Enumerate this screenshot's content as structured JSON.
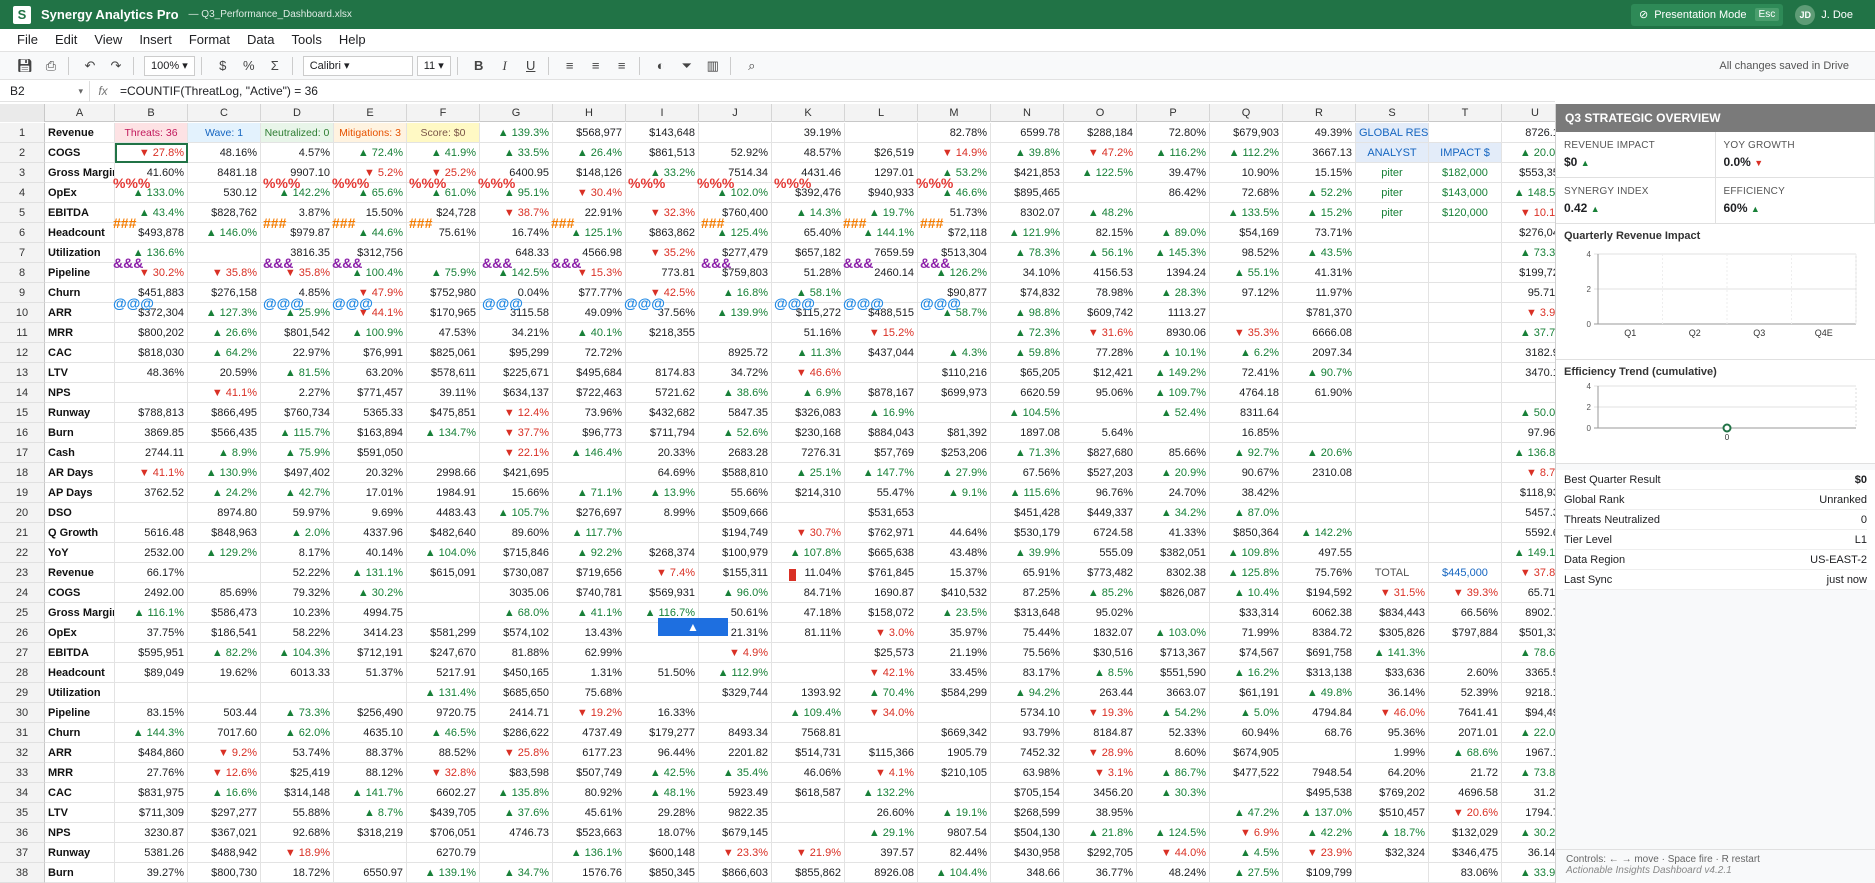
{
  "titlebar": {
    "logo": "S",
    "app_name": "Synergy Analytics Pro",
    "doc_name": "— Q3_Performance_Dashboard.xlsx",
    "pres_label": "Presentation Mode",
    "pres_key": "Esc",
    "user_initials": "JD",
    "user_name": "J. Doe"
  },
  "menu": [
    "File",
    "Edit",
    "View",
    "Insert",
    "Format",
    "Data",
    "Tools",
    "Help"
  ],
  "toolbar": {
    "zoom": "100% ▾",
    "font": "Calibri ▾",
    "size": "11 ▾",
    "saved": "All changes saved in Drive"
  },
  "formula": {
    "cell": "B2",
    "fx": "fx",
    "text": "=COUNTIF(ThreatLog, \"Active\") = 36"
  },
  "columns": [
    "A",
    "B",
    "C",
    "D",
    "E",
    "F",
    "G",
    "H",
    "I",
    "J",
    "K",
    "L",
    "M",
    "N",
    "O",
    "P",
    "Q",
    "R",
    "S",
    "T",
    "U"
  ],
  "rows": [
    [
      "Revenue",
      "Threats: 36",
      "Wave: 1",
      "Neutralized: 0",
      "Mitigations: 3",
      "Score: $0",
      "▲ 139.3%",
      "$568,977",
      "$143,648",
      "",
      "39.19%",
      "",
      "82.78%",
      "6599.78",
      "$288,184",
      "72.80%",
      "$679,903",
      "49.39%",
      "GLOBAL RES",
      "",
      "8726.10"
    ],
    [
      "COGS",
      "▼ 27.8%",
      "48.16%",
      "4.57%",
      "▲ 72.4%",
      "▲ 41.9%",
      "▲ 33.5%",
      "▲ 26.4%",
      "$861,513",
      "52.92%",
      "48.57%",
      "$26,519",
      "▼ 14.9%",
      "▲ 39.8%",
      "▼ 47.2%",
      "▲ 116.2%",
      "▲ 112.2%",
      "3667.13",
      "ANALYST",
      "IMPACT $",
      "▲ 20.0%"
    ],
    [
      "Gross Margin",
      "41.60%",
      "8481.18",
      "9907.10",
      "▼ 5.2%",
      "▼ 25.2%",
      "6400.95",
      "$148,126",
      "▲ 33.2%",
      "7514.34",
      "4431.46",
      "1297.01",
      "▲ 53.2%",
      "$421,853",
      "▲ 122.5%",
      "39.47%",
      "10.90%",
      "15.15%",
      "piter",
      "$182,000",
      "$553,354"
    ],
    [
      "OpEx",
      "▲ 133.0%",
      "530.12",
      "▲ 142.2%",
      "▲ 65.6%",
      "▲ 61.0%",
      "▲ 95.1%",
      "▼ 30.4%",
      "",
      "▲ 102.0%",
      "$392,476",
      "$940,933",
      "▲ 46.6%",
      "$895,465",
      "",
      "86.42%",
      "72.68%",
      "▲ 52.2%",
      "piter",
      "$143,000",
      "▲ 148.5%"
    ],
    [
      "EBITDA",
      "▲ 43.4%",
      "$828,762",
      "3.87%",
      "15.50%",
      "$24,728",
      "▼ 38.7%",
      "22.91%",
      "▼ 32.3%",
      "$760,400",
      "▲ 14.3%",
      "▲ 19.7%",
      "51.73%",
      "8302.07",
      "▲ 48.2%",
      "",
      "▲ 133.5%",
      "▲ 15.2%",
      "piter",
      "$120,000",
      "▼ 10.1%"
    ],
    [
      "Headcount",
      "$493,878",
      "▲ 146.0%",
      "$979.87",
      "▲ 44.6%",
      "75.61%",
      "16.74%",
      "▲ 125.1%",
      "$863,862",
      "▲ 125.4%",
      "65.40%",
      "▲ 144.1%",
      "$72,118",
      "▲ 121.9%",
      "82.15%",
      "▲ 89.0%",
      "$54,169",
      "73.71%",
      "",
      "",
      "$276,045"
    ],
    [
      "Utilization",
      "▲ 136.6%",
      "",
      "3816.35",
      "$312,756",
      "",
      "648.33",
      "4566.98",
      "▼ 35.2%",
      "$277,479",
      "$657,182",
      "7659.59",
      "$513,304",
      "▲ 78.3%",
      "▲ 56.1%",
      "▲ 145.3%",
      "98.52%",
      "▲ 43.5%",
      "",
      "",
      "▲ 73.3%"
    ],
    [
      "Pipeline",
      "▼ 30.2%",
      "▼ 35.8%",
      "▼ 35.8%",
      "▲ 100.4%",
      "▲ 75.9%",
      "▲ 142.5%",
      "▼ 15.3%",
      "773.81",
      "$759,803",
      "51.28%",
      "2460.14",
      "▲ 126.2%",
      "34.10%",
      "4156.53",
      "1394.24",
      "▲ 55.1%",
      "41.31%",
      "",
      "",
      "$199,725"
    ],
    [
      "Churn",
      "$451,883",
      "$276,158",
      "4.85%",
      "▼ 47.9%",
      "$752,980",
      "0.04%",
      "$77.77%",
      "▼ 42.5%",
      "▲ 16.8%",
      "▲ 58.1%",
      "",
      "$90,877",
      "$74,832",
      "78.98%",
      "▲ 28.3%",
      "97.12%",
      "11.97%",
      "",
      "",
      "95.71%"
    ],
    [
      "ARR",
      "$372,304",
      "▲ 127.3%",
      "▲ 25.9%",
      "▼ 44.1%",
      "$170,965",
      "3115.58",
      "49.09%",
      "37.56%",
      "▲ 139.9%",
      "$115,272",
      "$488,515",
      "▲ 58.7%",
      "▲ 98.8%",
      "$609,742",
      "1113.27",
      "",
      "$781,370",
      "",
      "",
      "▼ 3.9%"
    ],
    [
      "MRR",
      "$800,202",
      "▲ 26.6%",
      "$801,542",
      "▲ 100.9%",
      "47.53%",
      "34.21%",
      "▲ 40.1%",
      "$218,355",
      "",
      "51.16%",
      "▼ 15.2%",
      "",
      "▲ 72.3%",
      "▼ 31.6%",
      "8930.06",
      "▼ 35.3%",
      "6666.08",
      "",
      "",
      "▲ 37.7%"
    ],
    [
      "CAC",
      "$818,030",
      "▲ 64.2%",
      "22.97%",
      "$76,991",
      "$825,061",
      "$95,299",
      "72.72%",
      "",
      "8925.72",
      "▲ 11.3%",
      "$437,044",
      "▲ 4.3%",
      "▲ 59.8%",
      "77.28%",
      "▲ 10.1%",
      "▲ 6.2%",
      "2097.34",
      "",
      "",
      "3182.97"
    ],
    [
      "LTV",
      "48.36%",
      "20.59%",
      "▲ 81.5%",
      "63.20%",
      "$578,611",
      "$225,671",
      "$495,684",
      "8174.83",
      "34.72%",
      "▼ 46.6%",
      "",
      "$110,216",
      "$65,205",
      "$12,421",
      "▲ 149.2%",
      "72.41%",
      "▲ 90.7%",
      "",
      "",
      "3470.16"
    ],
    [
      "NPS",
      "",
      "▼ 41.1%",
      "2.27%",
      "$771,457",
      "39.11%",
      "$634,137",
      "$722,463",
      "5721.62",
      "▲ 38.6%",
      "▲ 6.9%",
      "$878,167",
      "$699,973",
      "6620.59",
      "95.06%",
      "▲ 109.7%",
      "4764.18",
      "61.90%",
      "",
      "",
      ""
    ],
    [
      "Runway",
      "$788,813",
      "$866,495",
      "$760,734",
      "5365.33",
      "$475,851",
      "▼ 12.4%",
      "73.96%",
      "$432,682",
      "5847.35",
      "$326,083",
      "▲ 16.9%",
      "",
      "▲ 104.5%",
      "",
      "▲ 52.4%",
      "8311.64",
      "",
      "",
      "",
      "▲ 50.0%"
    ],
    [
      "Burn",
      "3869.85",
      "$566,435",
      "▲ 115.7%",
      "$163,894",
      "▲ 134.7%",
      "▼ 37.7%",
      "$96,773",
      "$711,794",
      "▲ 52.6%",
      "$230,168",
      "$884,043",
      "$81,392",
      "1897.08",
      "5.64%",
      "",
      "16.85%",
      "",
      "",
      "",
      "97.96%"
    ],
    [
      "Cash",
      "2744.11",
      "▲ 8.9%",
      "▲ 75.9%",
      "$591,050",
      "",
      "▼ 22.1%",
      "▲ 146.4%",
      "20.33%",
      "2683.28",
      "7276.31",
      "$57,769",
      "$253,206",
      "▲ 71.3%",
      "$827,680",
      "85.66%",
      "▲ 92.7%",
      "▲ 20.6%",
      "",
      "",
      "▲ 136.8%"
    ],
    [
      "AR Days",
      "▼ 41.1%",
      "▲ 130.9%",
      "$497,402",
      "20.32%",
      "2998.66",
      "$421,695",
      "",
      "64.69%",
      "$588,810",
      "▲ 25.1%",
      "▲ 147.7%",
      "▲ 27.9%",
      "67.56%",
      "$527,203",
      "▲ 20.9%",
      "90.67%",
      "2310.08",
      "",
      "",
      "▼ 8.7%"
    ],
    [
      "AP Days",
      "3762.52",
      "▲ 24.2%",
      "▲ 42.7%",
      "17.01%",
      "1984.91",
      "15.66%",
      "▲ 71.1%",
      "▲ 13.9%",
      "55.66%",
      "$214,310",
      "55.47%",
      "▲ 9.1%",
      "▲ 115.6%",
      "96.76%",
      "24.70%",
      "38.42%",
      "",
      "",
      "",
      "$118,930"
    ],
    [
      "DSO",
      "",
      "8974.80",
      "59.97%",
      "9.69%",
      "4483.43",
      "▲ 105.7%",
      "$276,697",
      "8.99%",
      "$509,666",
      "",
      "$531,653",
      "",
      "$451,428",
      "$449,337",
      "▲ 34.2%",
      "▲ 87.0%",
      "",
      "",
      "",
      "5457.38"
    ],
    [
      "Q Growth",
      "5616.48",
      "$848,963",
      "▲ 2.0%",
      "4337.96",
      "$482,640",
      "89.60%",
      "▲ 117.7%",
      "",
      "$194,749",
      "▼ 30.7%",
      "$762,971",
      "44.64%",
      "$530,179",
      "6724.58",
      "41.33%",
      "$850,364",
      "▲ 142.2%",
      "",
      "",
      "5592.66"
    ],
    [
      "YoY",
      "2532.00",
      "▲ 129.2%",
      "8.17%",
      "40.14%",
      "▲ 104.0%",
      "$715,846",
      "▲ 92.2%",
      "$268,374",
      "$100,979",
      "▲ 107.8%",
      "$665,638",
      "43.48%",
      "▲ 39.9%",
      "555.09",
      "$382,051",
      "▲ 109.8%",
      "497.55",
      "",
      "",
      "▲ 149.1%"
    ],
    [
      "Revenue",
      "66.17%",
      "",
      "52.22%",
      "▲ 131.1%",
      "$615,091",
      "$730,087",
      "$719,656",
      "▼ 7.4%",
      "$155,311",
      "11.04%",
      "$761,845",
      "15.37%",
      "65.91%",
      "$773,482",
      "8302.38",
      "▲ 125.8%",
      "75.76%",
      "TOTAL",
      "$445,000",
      "▼ 37.8%"
    ],
    [
      "COGS",
      "2492.00",
      "85.69%",
      "79.32%",
      "▲ 30.2%",
      "",
      "3035.06",
      "$740,781",
      "$569,931",
      "▲ 96.0%",
      "84.71%",
      "1690.87",
      "$410,532",
      "87.25%",
      "▲ 85.2%",
      "$826,087",
      "▲ 10.4%",
      "$194,592",
      "▼ 31.5%",
      "▼ 39.3%",
      "65.71%"
    ],
    [
      "Gross Margin",
      "▲ 116.1%",
      "$586,473",
      "10.23%",
      "4994.75",
      "",
      "▲ 68.0%",
      "▲ 41.1%",
      "▲ 116.7%",
      "50.61%",
      "47.18%",
      "$158,072",
      "▲ 23.5%",
      "$313,648",
      "95.02%",
      "",
      "$33,314",
      "6062.38",
      "$834,443",
      "66.56%",
      "8902.72"
    ],
    [
      "OpEx",
      "37.75%",
      "$186,541",
      "58.22%",
      "3414.23",
      "$581,299",
      "$574,102",
      "13.43%",
      "",
      "21.31%",
      "81.11%",
      "▼ 3.0%",
      "35.97%",
      "75.44%",
      "1832.07",
      "▲ 103.0%",
      "71.99%",
      "8384.72",
      "$305,826",
      "$797,884",
      "$501,334"
    ],
    [
      "EBITDA",
      "$595,951",
      "▲ 82.2%",
      "▲ 104.3%",
      "$712,191",
      "$247,670",
      "81.88%",
      "62.99%",
      "",
      "▼ 4.9%",
      "",
      "$25,573",
      "21.19%",
      "75.56%",
      "$30,516",
      "$713,367",
      "$74,567",
      "$691,758",
      "▲ 141.3%",
      "",
      "▲ 78.6%"
    ],
    [
      "Headcount",
      "$89,049",
      "19.62%",
      "6013.33",
      "51.37%",
      "5217.91",
      "$450,165",
      "1.31%",
      "51.50%",
      "▲ 112.9%",
      "",
      "▼ 42.1%",
      "33.45%",
      "83.17%",
      "▲ 8.5%",
      "$551,590",
      "▲ 16.2%",
      "$313,138",
      "$33,636",
      "2.60%",
      "3365.54"
    ],
    [
      "Utilization",
      "",
      "",
      "",
      "",
      "▲ 131.4%",
      "$685,650",
      "75.68%",
      "",
      "$329,744",
      "1393.92",
      "▲ 70.4%",
      "$584,299",
      "▲ 94.2%",
      "263.44",
      "3663.07",
      "$61,191",
      "▲ 49.8%",
      "36.14%",
      "52.39%",
      "9218.15"
    ],
    [
      "Pipeline",
      "83.15%",
      "503.44",
      "▲ 73.3%",
      "$256,490",
      "9720.75",
      "2414.71",
      "▼ 19.2%",
      "16.33%",
      "",
      "▲ 109.4%",
      "▼ 34.0%",
      "",
      "5734.10",
      "▼ 19.3%",
      "▲ 54.2%",
      "▲ 5.0%",
      "4794.84",
      "▼ 46.0%",
      "7641.41",
      "$94,498"
    ],
    [
      "Churn",
      "▲ 144.3%",
      "7017.60",
      "▲ 62.0%",
      "4635.10",
      "▲ 46.5%",
      "$286,622",
      "4737.49",
      "$179,277",
      "8493.34",
      "7568.81",
      "",
      "$669,342",
      "93.79%",
      "8184.87",
      "52.33%",
      "60.94%",
      "68.76",
      "95.36%",
      "2071.01",
      "▲ 22.0%"
    ],
    [
      "ARR",
      "$484,860",
      "▼ 9.2%",
      "53.74%",
      "88.37%",
      "88.52%",
      "▼ 25.8%",
      "6177.23",
      "96.44%",
      "2201.82",
      "$514,731",
      "$115,366",
      "1905.79",
      "7452.32",
      "▼ 28.9%",
      "8.60%",
      "$674,905",
      "",
      "1.99%",
      "▲ 68.6%",
      "1967.10"
    ],
    [
      "MRR",
      "27.76%",
      "▼ 12.6%",
      "$25,419",
      "88.12%",
      "▼ 32.8%",
      "$83,598",
      "$507,749",
      "▲ 42.5%",
      "▲ 35.4%",
      "46.06%",
      "▼ 4.1%",
      "$210,105",
      "63.98%",
      "▼ 3.1%",
      "▲ 86.7%",
      "$477,522",
      "7948.54",
      "64.20%",
      "21.72",
      "▲ 73.8%"
    ],
    [
      "CAC",
      "$831,975",
      "▲ 16.6%",
      "$314,148",
      "▲ 141.7%",
      "6602.27",
      "▲ 135.8%",
      "80.92%",
      "▲ 48.1%",
      "5923.49",
      "$618,587",
      "▲ 132.2%",
      "",
      "$705,154",
      "3456.20",
      "▲ 30.3%",
      "",
      "$495,538",
      "$769,202",
      "4696.58",
      "31.2%"
    ],
    [
      "LTV",
      "$711,309",
      "$297,277",
      "55.88%",
      "▲ 8.7%",
      "$439,705",
      "▲ 37.6%",
      "45.61%",
      "29.28%",
      "9822.35",
      "",
      "26.60%",
      "▲ 19.1%",
      "$268,599",
      "38.95%",
      "",
      "▲ 47.2%",
      "▲ 137.0%",
      "$510,457",
      "▼ 20.6%",
      "1794.73"
    ],
    [
      "NPS",
      "3230.87",
      "$367,021",
      "92.68%",
      "$318,219",
      "$706,051",
      "4746.73",
      "$523,663",
      "18.07%",
      "$679,145",
      "",
      "▲ 29.1%",
      "9807.54",
      "$504,130",
      "▲ 21.8%",
      "▲ 124.5%",
      "▼ 6.9%",
      "▲ 42.2%",
      "▲ 18.7%",
      "$132,029",
      "▲ 30.2%"
    ],
    [
      "Runway",
      "5381.26",
      "$488,942",
      "▼ 18.9%",
      "",
      "6270.79",
      "",
      "▲ 136.1%",
      "$600,148",
      "▼ 23.3%",
      "▼ 21.9%",
      "397.57",
      "82.44%",
      "$430,958",
      "$292,705",
      "▼ 44.0%",
      "▲ 4.5%",
      "▼ 23.9%",
      "$32,324",
      "$346,475",
      "36.14%"
    ],
    [
      "Burn",
      "39.27%",
      "$800,730",
      "18.72%",
      "6550.97",
      "▲ 139.1%",
      "▲ 34.7%",
      "1576.76",
      "$850,345",
      "$866,603",
      "$855,862",
      "8926.08",
      "▲ 104.4%",
      "348.66",
      "36.77%",
      "48.24%",
      "▲ 27.5%",
      "$109,799",
      "",
      "83.06%",
      "▲ 33.9%"
    ]
  ],
  "special_cells": {
    "b1_bg": "#fde2e4",
    "c1_bg": "#e3f2fd",
    "d1_bg": "#e8f5e9",
    "e1_bg": "#fff3e0",
    "f1_bg": "#fff9c4",
    "s_bg": "#e3ecf9"
  },
  "panel": {
    "title": "Q3 STRATEGIC OVERVIEW",
    "kpis": [
      {
        "label": "REVENUE IMPACT",
        "value": "$0 ▲"
      },
      {
        "label": "YOY GROWTH",
        "value": "0.0% ▼"
      },
      {
        "label": "SYNERGY INDEX",
        "value": "0.42 ▲"
      },
      {
        "label": "EFFICIENCY",
        "value": "60% ▲"
      }
    ],
    "chart1_title": "Quarterly Revenue Impact",
    "chart2_title": "Efficiency Trend (cumulative)",
    "stats": [
      {
        "label": "Best Quarter Result",
        "value": "$0"
      },
      {
        "label": "Global Rank",
        "value": "Unranked"
      },
      {
        "label": "Threats Neutralized",
        "value": "0"
      },
      {
        "label": "Tier Level",
        "value": "L1"
      },
      {
        "label": "Data Region",
        "value": "US-EAST-2"
      },
      {
        "label": "Last Sync",
        "value": "just now"
      }
    ],
    "footer_controls": "Controls: ← → move · Space fire · R restart",
    "footer_version": "Actionable Insights Dashboard v4.2.1"
  },
  "chart_data": [
    {
      "type": "bar",
      "title": "Quarterly Revenue Impact",
      "categories": [
        "Q1",
        "Q2",
        "Q3",
        "Q4E"
      ],
      "values": [
        0,
        0,
        0,
        0
      ],
      "ylim": [
        0,
        4
      ],
      "yticks": [
        0,
        2,
        4
      ]
    },
    {
      "type": "line",
      "title": "Efficiency Trend (cumulative)",
      "x": [
        0
      ],
      "values": [
        0
      ],
      "ylim": [
        0,
        4
      ],
      "yticks": [
        0,
        2,
        4
      ]
    }
  ],
  "game": {
    "player_glyph": "▲",
    "invaders": {
      "row_pct": "%%%",
      "row_hash": "###",
      "row_amp": "&&&",
      "row_at": "@@@"
    }
  },
  "colors": {
    "brand": "#217346",
    "up": "#188038",
    "down": "#d93025",
    "player": "#1e6fe0"
  }
}
